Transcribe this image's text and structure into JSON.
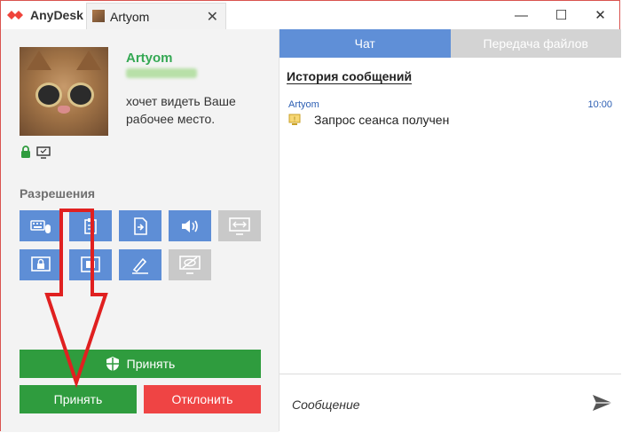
{
  "titlebar": {
    "app_name": "AnyDesk",
    "tab_title": "Artyom",
    "tab_close": "✕",
    "minimize": "—",
    "maximize": "☐",
    "close": "✕"
  },
  "session": {
    "user_name": "Artyom",
    "request_text": "хочет видеть Ваше рабочее место.",
    "permissions_title": "Разрешения",
    "permissions": [
      {
        "name": "keyboard-mouse-icon",
        "enabled": true
      },
      {
        "name": "clipboard-icon",
        "enabled": true
      },
      {
        "name": "file-transfer-icon",
        "enabled": true
      },
      {
        "name": "sound-icon",
        "enabled": true
      },
      {
        "name": "tcp-tunnel-icon",
        "enabled": false
      },
      {
        "name": "lock-icon",
        "enabled": true
      },
      {
        "name": "restart-icon",
        "enabled": true
      },
      {
        "name": "draw-icon",
        "enabled": true
      },
      {
        "name": "privacy-icon",
        "enabled": false
      }
    ],
    "accept_full_label": "Принять",
    "accept_label": "Принять",
    "decline_label": "Отклонить"
  },
  "chat": {
    "tabs": [
      {
        "label": "Чат",
        "active": true
      },
      {
        "label": "Передача файлов",
        "active": false
      }
    ],
    "history_title": "История сообщений",
    "messages": [
      {
        "author": "Artyom",
        "time": "10:00",
        "text": "Запрос сеанса получен"
      }
    ],
    "input_placeholder": "Сообщение"
  },
  "colors": {
    "accent_blue": "#5f8fd7",
    "accept_green": "#2f9c3e",
    "decline_red": "#ef4444",
    "name_green": "#34a853",
    "annotation_red": "#e02020"
  }
}
